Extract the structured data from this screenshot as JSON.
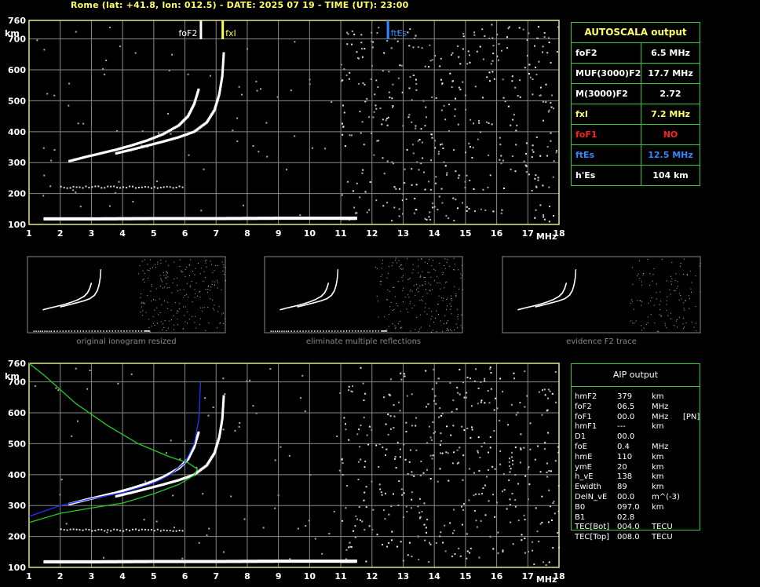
{
  "header": "Rome (lat: +41.8, lon: 012.5) - DATE: 2025 07 19 - TIME (UT): 23:00",
  "colors": {
    "frame": "#e6e68c",
    "grid": "#888888",
    "table": "#33cc33",
    "yellow": "#ffff66",
    "red": "#ff2020",
    "blue": "#3388ff",
    "fit_green": "#22cc22",
    "fit_blue": "#2233ff"
  },
  "axes": {
    "x_ticks": [
      1,
      2,
      3,
      4,
      5,
      6,
      7,
      8,
      9,
      10,
      11,
      12,
      13,
      14,
      15,
      16,
      17,
      18
    ],
    "x_unit": "MHz",
    "y_ticks": [
      100,
      200,
      300,
      400,
      500,
      600,
      700,
      760
    ],
    "y_unit": "km"
  },
  "markers": [
    {
      "label": "foF2",
      "freq": 6.5,
      "color": "#ffffff"
    },
    {
      "label": "fxI",
      "freq": 7.2,
      "color": "#ffff44"
    },
    {
      "label": "ftEs",
      "freq": 12.5,
      "color": "#3388ff"
    }
  ],
  "autoscala": {
    "title": "AUTOSCALA output",
    "rows": [
      {
        "key": "foF2",
        "value": "6.5 MHz",
        "kcolor": "#ffffff",
        "vcolor": "#ffffff"
      },
      {
        "key": "MUF(3000)F2",
        "value": "17.7 MHz",
        "kcolor": "#ffffff",
        "vcolor": "#ffffff"
      },
      {
        "key": "M(3000)F2",
        "value": "2.72",
        "kcolor": "#ffffff",
        "vcolor": "#ffffff"
      },
      {
        "key": "fxI",
        "value": "7.2 MHz",
        "kcolor": "#ffff66",
        "vcolor": "#ffff66"
      },
      {
        "key": "foF1",
        "value": "NO",
        "kcolor": "#ff2020",
        "vcolor": "#ff2020"
      },
      {
        "key": "ftEs",
        "value": "12.5 MHz",
        "kcolor": "#3388ff",
        "vcolor": "#3388ff"
      },
      {
        "key": "h'Es",
        "value": "104    km",
        "kcolor": "#ffffff",
        "vcolor": "#ffffff"
      }
    ]
  },
  "thumbs": [
    {
      "caption": "original ionogram resized"
    },
    {
      "caption": "eliminate multiple reflections"
    },
    {
      "caption": "evidence F2 trace"
    }
  ],
  "aip": {
    "title": "AIP output",
    "rows": [
      [
        "hmF2",
        "379",
        "km",
        ""
      ],
      [
        "foF2",
        "06.5",
        "MHz",
        ""
      ],
      [
        "foF1",
        "00.0",
        "MHz",
        "[PN]"
      ],
      [
        "hmF1",
        "---",
        "km",
        ""
      ],
      [
        "D1",
        "00.0",
        "",
        ""
      ],
      [
        "foE",
        "0.4",
        "MHz",
        ""
      ],
      [
        "hmE",
        "110",
        "km",
        ""
      ],
      [
        "ymE",
        "20",
        "km",
        ""
      ],
      [
        "h_vE",
        "138",
        "km",
        ""
      ],
      [
        "Ewidth",
        "89",
        "km",
        ""
      ],
      [
        "DelN_vE",
        "00.0",
        "m^(-3)",
        ""
      ],
      [
        "B0",
        "097.0",
        "km",
        ""
      ],
      [
        "B1",
        "02.8",
        "",
        ""
      ],
      [
        "TEC[Bot]",
        "004.0",
        "TECU",
        ""
      ],
      [
        "TEC[Top]",
        "008.0",
        "TECU",
        ""
      ]
    ]
  },
  "chart_data": [
    {
      "type": "scatter",
      "title": "",
      "xlabel": "MHz",
      "ylabel": "km",
      "xlim": [
        1,
        18
      ],
      "ylim": [
        100,
        760
      ],
      "series": [
        {
          "name": "F2 ordinary trace",
          "x": [
            2.3,
            2.8,
            3.3,
            3.8,
            4.3,
            4.8,
            5.3,
            5.8,
            6.1,
            6.3,
            6.45
          ],
          "y": [
            305,
            318,
            330,
            342,
            356,
            372,
            392,
            420,
            450,
            490,
            540
          ]
        },
        {
          "name": "F2 extraordinary trace",
          "x": [
            3.8,
            4.3,
            4.8,
            5.3,
            5.8,
            6.3,
            6.7,
            6.95,
            7.1,
            7.2,
            7.25
          ],
          "y": [
            330,
            342,
            355,
            368,
            382,
            400,
            430,
            470,
            520,
            580,
            660
          ]
        },
        {
          "name": "Es trace",
          "x": [
            1.5,
            3,
            5,
            7,
            9,
            11,
            11.5
          ],
          "y": [
            118,
            118,
            119,
            119,
            120,
            120,
            120
          ]
        }
      ]
    },
    {
      "type": "line",
      "title": "",
      "xlabel": "MHz",
      "ylabel": "km",
      "xlim": [
        1,
        18
      ],
      "ylim": [
        100,
        760
      ],
      "series": [
        {
          "name": "",
          "color": "#2233ff",
          "x": [
            1,
            2,
            3,
            4,
            5,
            5.5,
            6,
            6.3,
            6.45,
            6.5
          ],
          "y": [
            265,
            300,
            322,
            342,
            372,
            398,
            438,
            500,
            580,
            700
          ]
        },
        {
          "name": "",
          "color": "#22cc22",
          "x": [
            1,
            2,
            3,
            4,
            5,
            5.8,
            6.3,
            6.4,
            6.1,
            5.5,
            4.5,
            3.5,
            2.5,
            1.5,
            1
          ],
          "y": [
            245,
            275,
            292,
            308,
            338,
            368,
            398,
            418,
            438,
            458,
            500,
            560,
            630,
            720,
            760
          ]
        }
      ]
    }
  ]
}
